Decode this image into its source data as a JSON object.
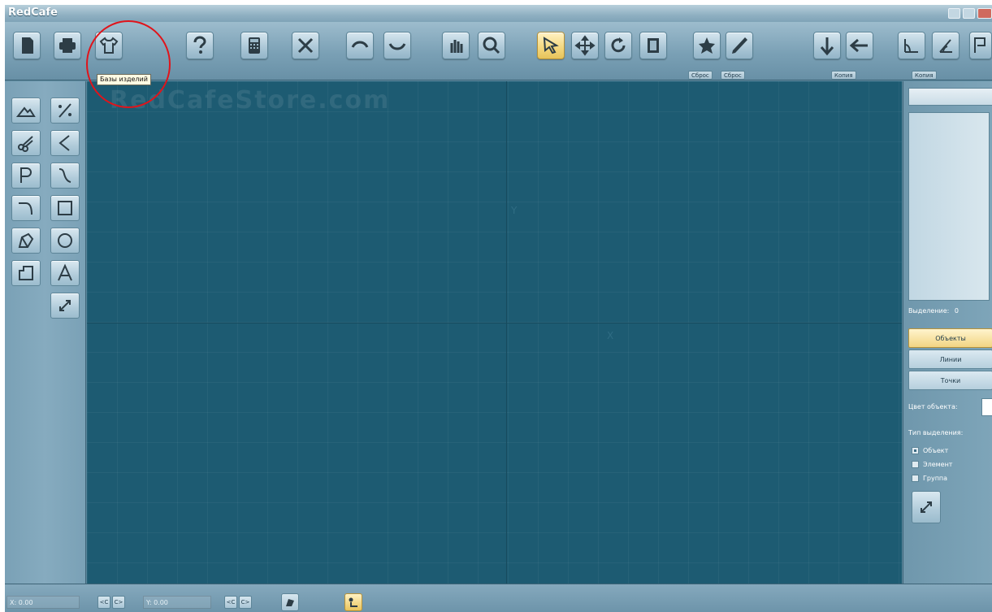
{
  "app": {
    "title": "RedCafe"
  },
  "toolbar": {
    "tooltip": "Базы изделий",
    "labels": {
      "reset1": "Сброс",
      "reset2": "Сброс",
      "copy1": "Копия",
      "copy2": "Копия"
    }
  },
  "canvas": {
    "watermark": "RedCafeStore.com",
    "axis_y": "Y",
    "axis_x": "X"
  },
  "right_panel": {
    "selection_label": "Выделение:",
    "selection_count": "0",
    "btn_objects": "Объекты",
    "btn_lines": "Линии",
    "btn_points": "Точки",
    "object_color_label": "Цвет объекта:",
    "object_color": "#ffffff",
    "selection_type_label": "Тип выделения:",
    "options": [
      "Объект",
      "Элемент",
      "Группа"
    ]
  },
  "status": {
    "x_label": "X:",
    "x_value": "0.00",
    "y_label": "Y:",
    "y_value": "0.00",
    "prev": "<C",
    "next": "C>"
  }
}
